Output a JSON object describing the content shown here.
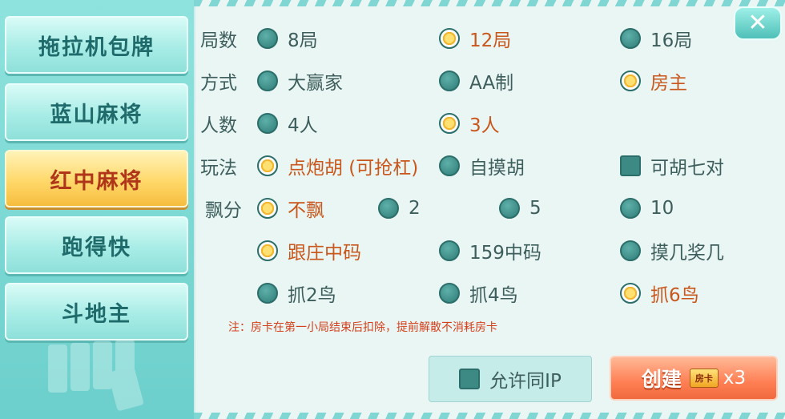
{
  "sidebar": {
    "tabs": [
      {
        "label": "拖拉机包牌",
        "active": false
      },
      {
        "label": "蓝山麻将",
        "active": false
      },
      {
        "label": "红中麻将",
        "active": true
      },
      {
        "label": "跑得快",
        "active": false
      },
      {
        "label": "斗地主",
        "active": false
      }
    ]
  },
  "settings": {
    "rounds": {
      "label": "局数",
      "options": [
        "8局",
        "12局",
        "16局"
      ],
      "selected": "12局"
    },
    "mode": {
      "label": "方式",
      "options": [
        "大赢家",
        "AA制",
        "房主"
      ],
      "selected": "房主"
    },
    "players": {
      "label": "人数",
      "options": [
        "4人",
        "3人"
      ],
      "selected": "3人"
    },
    "play": {
      "label": "玩法",
      "options": [
        "点炮胡 (可抢杠)",
        "自摸胡"
      ],
      "selected": "点炮胡 (可抢杠)",
      "checkbox": {
        "label": "可胡七对",
        "checked": false
      }
    },
    "float": {
      "label": "飘分",
      "options": [
        "不飘",
        "2",
        "5",
        "10"
      ],
      "selected": "不飘"
    },
    "birds1": {
      "options": [
        "跟庄中码",
        "159中码",
        "摸几奖几"
      ],
      "selected": "跟庄中码"
    },
    "birds2": {
      "options": [
        "抓2鸟",
        "抓4鸟",
        "抓6鸟"
      ],
      "selected": "抓6鸟"
    }
  },
  "note": "注：房卡在第一小局结束后扣除，提前解散不消耗房卡",
  "allow_ip": {
    "label": "允许同IP",
    "checked": false
  },
  "create": {
    "label": "创建",
    "card_icon": "房卡",
    "count": "x3"
  },
  "close_icon": "✕",
  "colors": {
    "accent": "#c9561b",
    "teal": "#2f7c77",
    "create": "#ff7f54",
    "active_tab": "#ffd86a"
  }
}
